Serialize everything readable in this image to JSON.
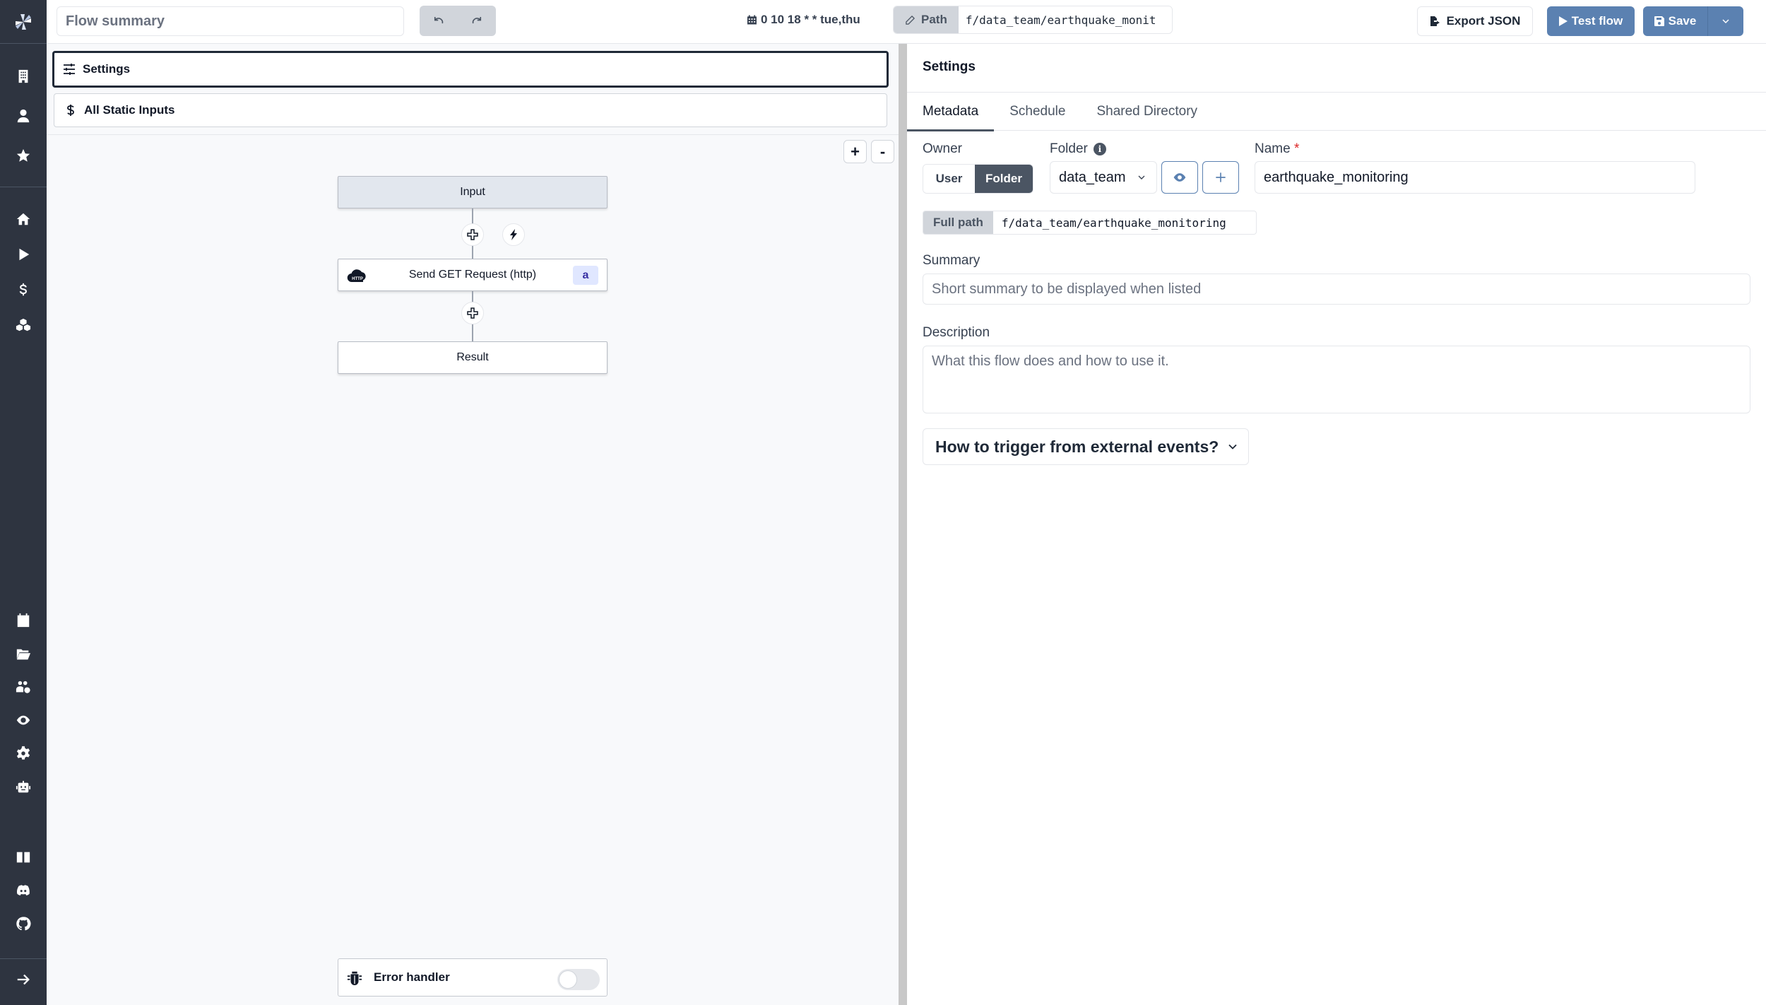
{
  "app": {
    "brand_color": "#5b81b1",
    "sidebar_color": "#2e3440"
  },
  "sidebar": {
    "top_items": [
      {
        "icon": "building-icon",
        "label": "Workspace"
      },
      {
        "icon": "user-icon",
        "label": "User"
      },
      {
        "icon": "star-icon",
        "label": "Favorites"
      }
    ],
    "main_items": [
      {
        "icon": "home-icon",
        "label": "Home"
      },
      {
        "icon": "play-icon",
        "label": "Runs"
      },
      {
        "icon": "dollar-icon",
        "label": "Variables"
      },
      {
        "icon": "cubes-icon",
        "label": "Resources"
      }
    ],
    "lower_items": [
      {
        "icon": "calendar-icon",
        "label": "Schedules"
      },
      {
        "icon": "folder-open-icon",
        "label": "Folders"
      },
      {
        "icon": "users-cog-icon",
        "label": "Groups"
      },
      {
        "icon": "eye-icon",
        "label": "Audit Logs"
      },
      {
        "icon": "gear-icon",
        "label": "Settings"
      },
      {
        "icon": "robot-icon",
        "label": "Workers"
      }
    ],
    "bottom_items": [
      {
        "icon": "book-icon",
        "label": "Docs"
      },
      {
        "icon": "discord-icon",
        "label": "Discord"
      },
      {
        "icon": "github-icon",
        "label": "GitHub"
      }
    ],
    "expand_icon": "arrow-right-icon"
  },
  "topbar": {
    "summary_placeholder": "Flow summary",
    "summary_value": "",
    "schedule": "0 10 18 * * tue,thu",
    "path_label": "Path",
    "path_value": "f/data_team/earthquake_monit",
    "export_label": "Export JSON",
    "test_label": "Test flow",
    "save_label": "Save"
  },
  "left_pane": {
    "panel_items": [
      {
        "label": "Settings",
        "icon": "sliders-icon",
        "active": true
      },
      {
        "label": "All Static Inputs",
        "icon": "dollar-icon",
        "active": false
      }
    ],
    "zoom_in": "+",
    "zoom_out": "-",
    "flow": {
      "input_node": "Input",
      "step_node": {
        "label": "Send GET Request (http)",
        "icon": "http-cloud-icon",
        "badge": "a"
      },
      "result_node": "Result"
    },
    "error_handler": {
      "label": "Error handler",
      "enabled": false
    }
  },
  "right_pane": {
    "title": "Settings",
    "tabs": [
      {
        "label": "Metadata",
        "active": true
      },
      {
        "label": "Schedule",
        "active": false
      },
      {
        "label": "Shared Directory",
        "active": false
      }
    ],
    "owner": {
      "label": "Owner",
      "options": [
        "User",
        "Folder"
      ],
      "selected": "Folder"
    },
    "folder": {
      "label": "Folder",
      "value": "data_team"
    },
    "name": {
      "label": "Name",
      "required_mark": "*",
      "value": "earthquake_monitoring"
    },
    "full_path": {
      "label": "Full path",
      "value": "f/data_team/earthquake_monitoring"
    },
    "summary": {
      "label": "Summary",
      "placeholder": "Short summary to be displayed when listed",
      "value": ""
    },
    "description": {
      "label": "Description",
      "placeholder": "What this flow does and how to use it.",
      "value": ""
    },
    "trigger_label": "How to trigger from external events?"
  }
}
